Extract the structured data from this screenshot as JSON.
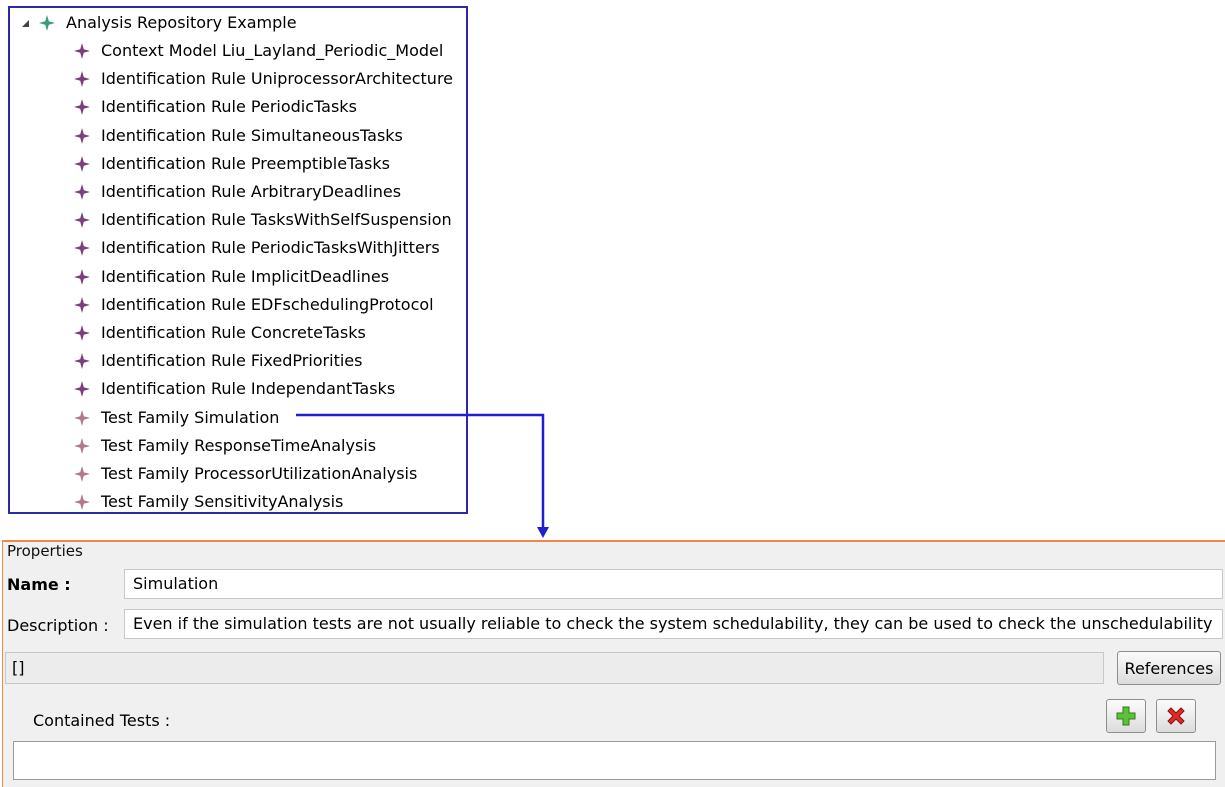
{
  "tree": {
    "root": {
      "label": "Analysis Repository Example",
      "icon": "green-star-icon"
    },
    "items": [
      {
        "label": "Context Model Liu_Layland_Periodic_Model",
        "icon": "purple-star-icon"
      },
      {
        "label": "Identification Rule UniprocessorArchitecture",
        "icon": "purple-star-icon"
      },
      {
        "label": "Identification Rule PeriodicTasks",
        "icon": "purple-star-icon"
      },
      {
        "label": "Identification Rule SimultaneousTasks",
        "icon": "purple-star-icon"
      },
      {
        "label": "Identification Rule PreemptibleTasks",
        "icon": "purple-star-icon"
      },
      {
        "label": "Identification Rule ArbitraryDeadlines",
        "icon": "purple-star-icon"
      },
      {
        "label": "Identification Rule TasksWithSelfSuspension",
        "icon": "purple-star-icon"
      },
      {
        "label": "Identification Rule PeriodicTasksWithJitters",
        "icon": "purple-star-icon"
      },
      {
        "label": "Identification Rule ImplicitDeadlines",
        "icon": "purple-star-icon"
      },
      {
        "label": "Identification Rule EDFschedulingProtocol",
        "icon": "purple-star-icon"
      },
      {
        "label": "Identification Rule ConcreteTasks",
        "icon": "purple-star-icon"
      },
      {
        "label": "Identification Rule FixedPriorities",
        "icon": "purple-star-icon"
      },
      {
        "label": "Identification Rule IndependantTasks",
        "icon": "purple-star-icon"
      },
      {
        "label": "Test Family Simulation",
        "icon": "pink-star-icon"
      },
      {
        "label": "Test Family ResponseTimeAnalysis",
        "icon": "pink-star-icon"
      },
      {
        "label": "Test Family ProcessorUtilizationAnalysis",
        "icon": "pink-star-icon"
      },
      {
        "label": "Test Family SensitivityAnalysis",
        "icon": "pink-star-icon"
      }
    ]
  },
  "colors": {
    "tree_border": "#2a2aa8",
    "arrow": "#1f1fd0",
    "panel_border": "#f0884a",
    "green_icon": "#3a9a7a",
    "purple_icon": "#7a3f7a",
    "pink_icon": "#b07a8a"
  },
  "properties": {
    "title": "Properties",
    "name_label": "Name :",
    "name_value": "Simulation",
    "description_label": "Description :",
    "description_value": "Even if the simulation tests are not usually reliable to check the system schedulability, they can be used to check the unschedulability",
    "references_value": "[]",
    "references_button": "References",
    "contained_tests_label": "Contained Tests :",
    "add_icon": "green-plus-icon",
    "remove_icon": "red-x-icon"
  }
}
